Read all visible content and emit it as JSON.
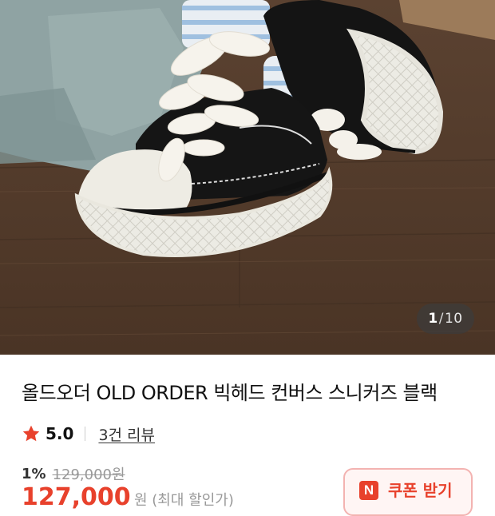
{
  "gallery": {
    "current": "1",
    "separator": "/",
    "total": "10",
    "image_alt": "black canvas sneakers with fluffy white laces"
  },
  "product": {
    "title": "올드오더 OLD ORDER 빅헤드 컨버스 스니커즈 블랙",
    "rating": "5.0",
    "review_link": "3건 리뷰",
    "discount": "1%",
    "original_price": "129,000원",
    "sale_price": "127,000",
    "sale_note": "원 (최대 할인가)"
  },
  "coupon": {
    "logo": "N",
    "label": "쿠폰 받기"
  },
  "colors": {
    "accent": "#e8412c",
    "coupon_border": "#f3b3b1",
    "coupon_bg": "#fff5f4"
  },
  "icons": {
    "rating": "star-icon",
    "coupon": "naver-logo-icon"
  }
}
